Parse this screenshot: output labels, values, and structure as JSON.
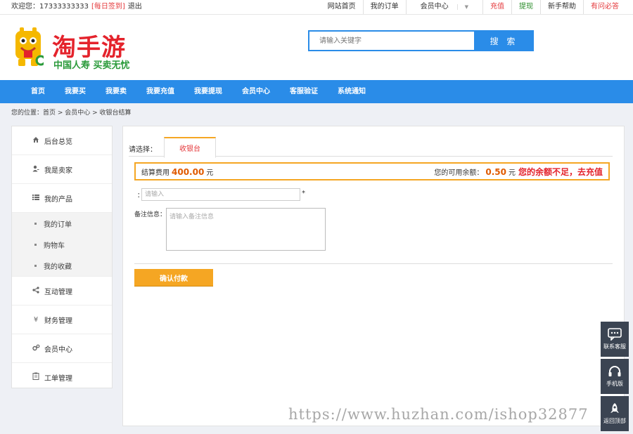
{
  "topbar": {
    "welcome": "欢迎您：",
    "phone": "17333333333",
    "signin": "[每日签到]",
    "logout": "退出",
    "links": [
      {
        "label": "网站首页"
      },
      {
        "label": "我的订单"
      },
      {
        "label": "会员中心"
      },
      {
        "label": "充值"
      },
      {
        "label": "提现"
      },
      {
        "label": "新手帮助"
      },
      {
        "label": "有问必答"
      }
    ]
  },
  "logo": {
    "text": "淘手游",
    "slogan": "中国人寿 买卖无忧"
  },
  "search": {
    "placeholder": "请输入关键字",
    "button": "搜 索"
  },
  "nav": [
    "首页",
    "我要买",
    "我要卖",
    "我要充值",
    "我要提现",
    "会员中心",
    "客服验证",
    "系统通知"
  ],
  "breadcrumb": "您的位置：首页 > 会员中心 > 收银台结算",
  "sidebar": {
    "items": [
      {
        "label": "后台总览",
        "icon": "home-icon"
      },
      {
        "label": "我是卖家",
        "icon": "user-icon"
      },
      {
        "label": "我的产品",
        "icon": "list-icon"
      },
      {
        "label": "互动管理",
        "icon": "share-icon"
      },
      {
        "label": "财务管理",
        "icon": "yen-icon"
      },
      {
        "label": "会员中心",
        "icon": "gears-icon"
      },
      {
        "label": "工单管理",
        "icon": "clipboard-icon"
      }
    ],
    "subitems": [
      "我的订单",
      "购物车",
      "我的收藏"
    ]
  },
  "main": {
    "select_label": "请选择：",
    "tab": "收银台",
    "fee_label": "结算费用",
    "fee_amount": "400.00",
    "fee_unit": "元",
    "balance_label": "您的可用余额：",
    "balance_amount": "0.50",
    "balance_unit": "元",
    "recharge": "您的余额不足，去充值",
    "input_label": "：",
    "input_placeholder": "请输入",
    "required_mark": "*",
    "remark_label": "备注信息：",
    "remark_placeholder": "请输入备注信息",
    "submit": "确认付款"
  },
  "float": [
    {
      "label": "联系客服",
      "icon": "chat-icon"
    },
    {
      "label": "手机版",
      "icon": "headset-icon"
    },
    {
      "label": "返回顶部",
      "icon": "rocket-icon"
    }
  ],
  "watermark": "https://www.huzhan.com/ishop32877",
  "colors": {
    "primary": "#2a8ce8",
    "accent": "#f5a623",
    "red": "#e4232c"
  }
}
